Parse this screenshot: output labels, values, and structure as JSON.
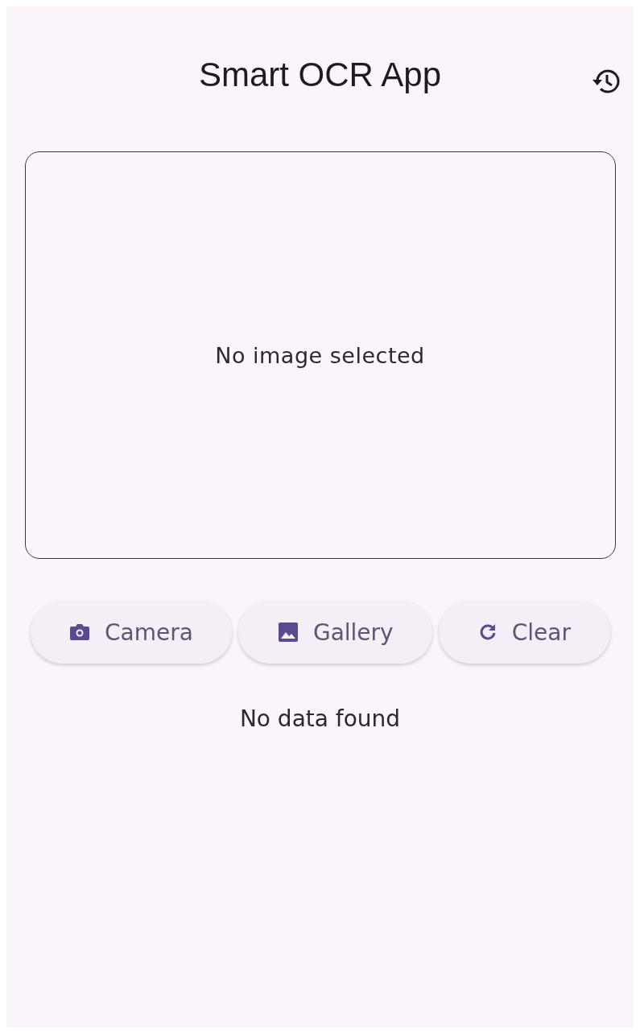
{
  "app_bar": {
    "title": "Smart OCR App"
  },
  "image_preview": {
    "message": "No image selected"
  },
  "buttons": [
    {
      "label": "Camera",
      "kind": "camera"
    },
    {
      "label": "Gallery",
      "kind": "gallery"
    },
    {
      "label": "Clear",
      "kind": "clear"
    }
  ],
  "result": {
    "text": "No data found"
  }
}
